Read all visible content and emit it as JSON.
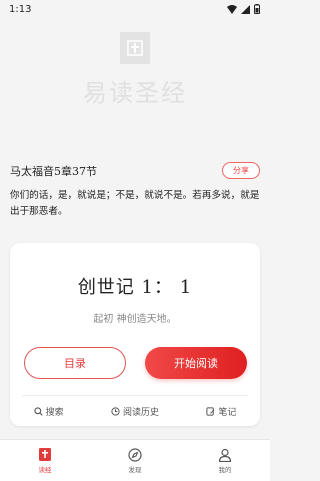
{
  "status_bar": {
    "time": "1:13"
  },
  "logo": {
    "text": "易读圣经"
  },
  "verse": {
    "reference": "马太福音5章37节",
    "share_label": "分享",
    "text": "你们的话，是，就说是；不是，就说不是。若再多说，就是出于那恶者。"
  },
  "card": {
    "title": "创世记 1： 1",
    "subtitle": "起初 神创造天地。",
    "toc_label": "目录",
    "read_label": "开始阅读",
    "links": [
      {
        "label": "搜索",
        "icon": "search-icon"
      },
      {
        "label": "阅读历史",
        "icon": "clock-icon"
      },
      {
        "label": "笔记",
        "icon": "note-icon"
      }
    ]
  },
  "tabbar": {
    "items": [
      {
        "label": "读经",
        "icon": "bible-icon",
        "active": true
      },
      {
        "label": "发现",
        "icon": "compass-icon",
        "active": false
      },
      {
        "label": "我的",
        "icon": "user-icon",
        "active": false
      }
    ]
  },
  "colors": {
    "accent": "#e03c3c",
    "background": "#f4f4f4"
  }
}
